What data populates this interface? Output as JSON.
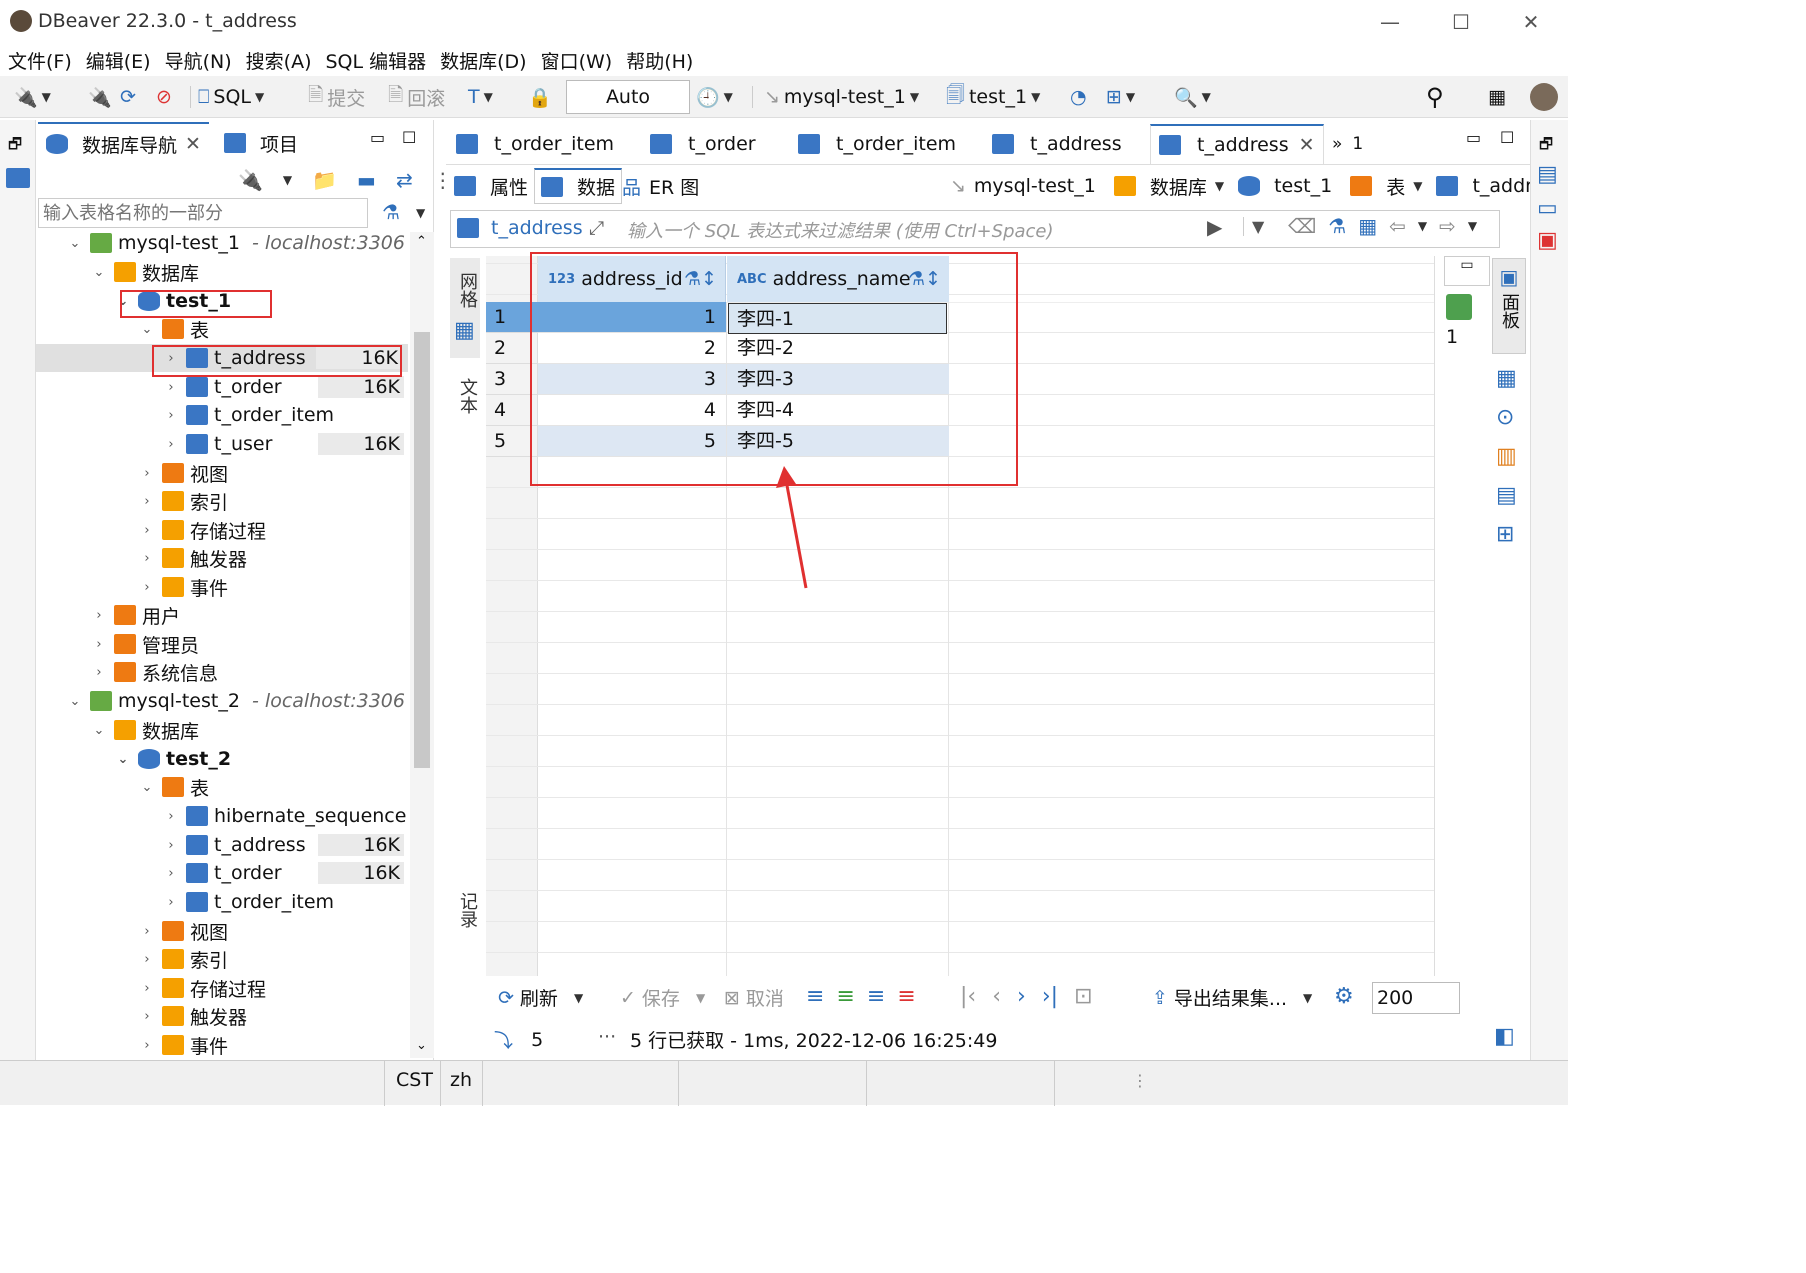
{
  "window": {
    "title": "DBeaver 22.3.0 - t_address",
    "minimize": "—",
    "maximize": "☐",
    "close": "✕"
  },
  "menu": [
    "文件(F)",
    "编辑(E)",
    "导航(N)",
    "搜索(A)",
    "SQL 编辑器",
    "数据库(D)",
    "窗口(W)",
    "帮助(H)"
  ],
  "toolbar": {
    "sql": "SQL",
    "commit": "提交",
    "rollback": "回滚",
    "tx_mode": "Auto",
    "connection": "mysql-test_1",
    "schema": "test_1"
  },
  "left": {
    "tabs": [
      "数据库导航",
      "项目"
    ],
    "search_placeholder": "输入表格名称的一部分",
    "tree": [
      {
        "label": "mysql-test_1",
        "suffix": "- localhost:3306"
      },
      {
        "label": "数据库"
      },
      {
        "label": "test_1"
      },
      {
        "label": "表"
      },
      {
        "label": "t_address",
        "size": "16K"
      },
      {
        "label": "t_order",
        "size": "16K"
      },
      {
        "label": "t_order_item"
      },
      {
        "label": "t_user",
        "size": "16K"
      },
      {
        "label": "视图"
      },
      {
        "label": "索引"
      },
      {
        "label": "存储过程"
      },
      {
        "label": "触发器"
      },
      {
        "label": "事件"
      },
      {
        "label": "用户"
      },
      {
        "label": "管理员"
      },
      {
        "label": "系统信息"
      },
      {
        "label": "mysql-test_2",
        "suffix": "- localhost:3306"
      },
      {
        "label": "数据库"
      },
      {
        "label": "test_2"
      },
      {
        "label": "表"
      },
      {
        "label": "hibernate_sequence"
      },
      {
        "label": "t_address",
        "size": "16K"
      },
      {
        "label": "t_order",
        "size": "16K"
      },
      {
        "label": "t_order_item"
      },
      {
        "label": "视图"
      },
      {
        "label": "索引"
      },
      {
        "label": "存储过程"
      },
      {
        "label": "触发器"
      },
      {
        "label": "事件"
      }
    ]
  },
  "editor": {
    "tabs": [
      "t_order_item",
      "t_order",
      "t_order_item",
      "t_address",
      "t_address"
    ],
    "overflow": "1",
    "subtabs": [
      "属性",
      "数据",
      "ER 图"
    ],
    "breadcrumb": [
      "mysql-test_1",
      "数据库",
      "test_1",
      "表",
      "t_address"
    ],
    "filter_label": "t_address",
    "filter_placeholder": "输入一个 SQL 表达式来过滤结果 (使用 Ctrl+Space)",
    "side_tabs": {
      "grid": "网格",
      "text": "文本",
      "record": "记录",
      "panel": "面板"
    },
    "right_count": "1"
  },
  "grid": {
    "columns": [
      {
        "type": "123",
        "name": "address_id"
      },
      {
        "type": "ABC",
        "name": "address_name"
      }
    ],
    "rows": [
      {
        "n": "1",
        "id": "1",
        "name": "李四-1"
      },
      {
        "n": "2",
        "id": "2",
        "name": "李四-2"
      },
      {
        "n": "3",
        "id": "3",
        "name": "李四-3"
      },
      {
        "n": "4",
        "id": "4",
        "name": "李四-4"
      },
      {
        "n": "5",
        "id": "5",
        "name": "李四-5"
      }
    ]
  },
  "bottom": {
    "refresh": "刷新",
    "save": "保存",
    "cancel": "取消",
    "export": "导出结果集...",
    "fetch_size": "200",
    "row_count": "5",
    "status": "5 行已获取 - 1ms, 2022-12-06 16:25:49"
  },
  "status": {
    "tz": "CST",
    "lang": "zh"
  },
  "colors": {
    "accent": "#2f6fba",
    "highlight": "#e03030",
    "selected": "#6aa4dc",
    "header": "#d4e4f4"
  }
}
